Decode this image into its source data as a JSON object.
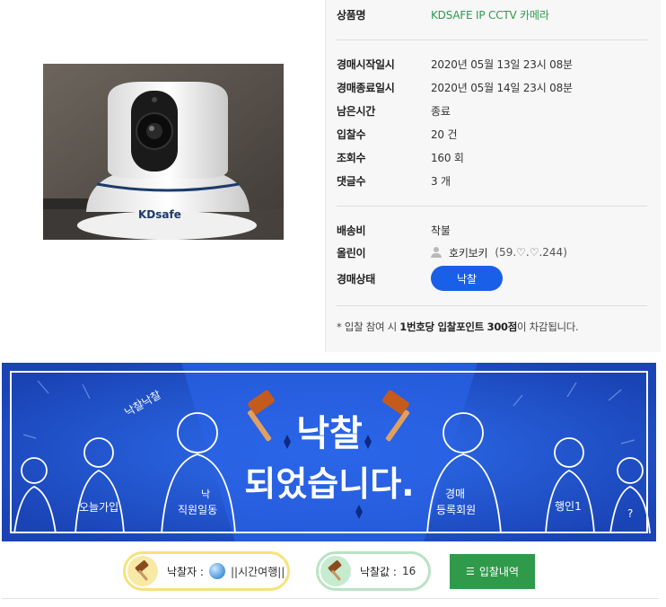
{
  "product": {
    "photo_logo_text": "KDsafe",
    "info": {
      "name_label": "상품명",
      "name_value": "KDSAFE IP CCTV 카메라",
      "start_label": "경매시작일시",
      "start_value": "2020년 05월 13일 23시 08분",
      "end_label": "경매종료일시",
      "end_value": "2020년 05월 14일 23시 08분",
      "remaining_label": "남은시간",
      "remaining_value": "종료",
      "bids_label": "입찰수",
      "bids_value": "20 건",
      "views_label": "조회수",
      "views_value": "160 회",
      "comments_label": "댓글수",
      "comments_value": "3 개",
      "shipping_label": "배송비",
      "shipping_value": "착불",
      "seller_label": "올린이",
      "seller_name": "호키보키",
      "seller_ip": "(59.♡.♡.244)",
      "status_label": "경매상태",
      "status_value": "낙찰"
    },
    "notice_prefix": "* 입찰 참여 시 ",
    "notice_bold": "1번호당 입찰포인트 300점",
    "notice_suffix": "이 차감됩니다."
  },
  "banner": {
    "headline_line1": "낙찰",
    "headline_line2": "되었습니다.",
    "figure_labels": [
      "오늘가입",
      "낙찰낙찰",
      "낙",
      "직원일동",
      "경매",
      "등록회원",
      "행인1",
      "?"
    ],
    "background_color": "#1f4fc9"
  },
  "result": {
    "winner_label": "낙찰자 :",
    "winner_name": "||시간여행||",
    "price_label": "낙찰값 :",
    "price_value": "16",
    "history_button": "입찰내역"
  },
  "colors": {
    "accent_blue": "#1a5fe8",
    "accent_green": "#2f9a4a",
    "product_name_green": "#2e9a52",
    "winner_border": "#f6e27c",
    "price_border": "#b9e3c4"
  },
  "icons": {
    "seller": "user-icon",
    "winner": "gavel-icon",
    "price": "gavel-icon",
    "winner_avatar": "globe-icon",
    "history": "list-icon"
  }
}
